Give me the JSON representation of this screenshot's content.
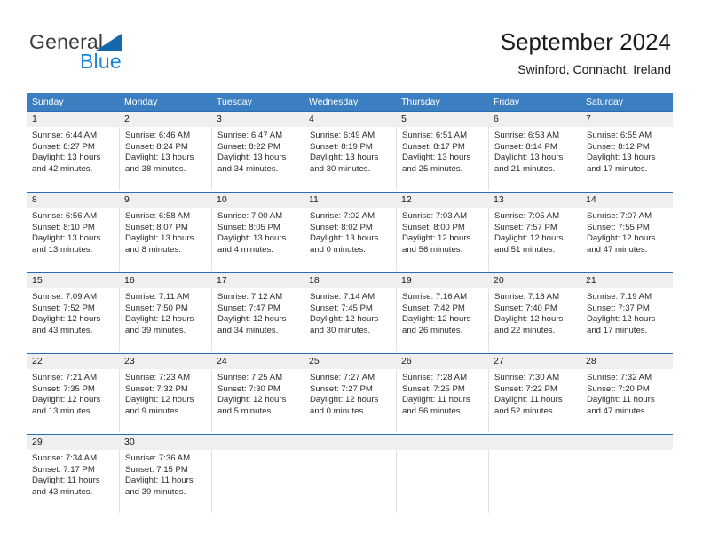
{
  "brand": {
    "name_top": "General",
    "name_bottom": "Blue",
    "triangle_color": "#1469ad",
    "blue_color": "#1c86d6"
  },
  "header": {
    "title": "September 2024",
    "subtitle": "Swinford, Connacht, Ireland"
  },
  "theme": {
    "header_bar": "#3c7fc0",
    "week_separator": "#2a6db3",
    "day_band": "#efefef",
    "cell_divider": "#e2e2e2",
    "text": "#1a1a1a"
  },
  "weekdays": [
    "Sunday",
    "Monday",
    "Tuesday",
    "Wednesday",
    "Thursday",
    "Friday",
    "Saturday"
  ],
  "weeks": [
    [
      {
        "day": "1",
        "sunrise": "Sunrise: 6:44 AM",
        "sunset": "Sunset: 8:27 PM",
        "daylight1": "Daylight: 13 hours",
        "daylight2": "and 42 minutes."
      },
      {
        "day": "2",
        "sunrise": "Sunrise: 6:46 AM",
        "sunset": "Sunset: 8:24 PM",
        "daylight1": "Daylight: 13 hours",
        "daylight2": "and 38 minutes."
      },
      {
        "day": "3",
        "sunrise": "Sunrise: 6:47 AM",
        "sunset": "Sunset: 8:22 PM",
        "daylight1": "Daylight: 13 hours",
        "daylight2": "and 34 minutes."
      },
      {
        "day": "4",
        "sunrise": "Sunrise: 6:49 AM",
        "sunset": "Sunset: 8:19 PM",
        "daylight1": "Daylight: 13 hours",
        "daylight2": "and 30 minutes."
      },
      {
        "day": "5",
        "sunrise": "Sunrise: 6:51 AM",
        "sunset": "Sunset: 8:17 PM",
        "daylight1": "Daylight: 13 hours",
        "daylight2": "and 25 minutes."
      },
      {
        "day": "6",
        "sunrise": "Sunrise: 6:53 AM",
        "sunset": "Sunset: 8:14 PM",
        "daylight1": "Daylight: 13 hours",
        "daylight2": "and 21 minutes."
      },
      {
        "day": "7",
        "sunrise": "Sunrise: 6:55 AM",
        "sunset": "Sunset: 8:12 PM",
        "daylight1": "Daylight: 13 hours",
        "daylight2": "and 17 minutes."
      }
    ],
    [
      {
        "day": "8",
        "sunrise": "Sunrise: 6:56 AM",
        "sunset": "Sunset: 8:10 PM",
        "daylight1": "Daylight: 13 hours",
        "daylight2": "and 13 minutes."
      },
      {
        "day": "9",
        "sunrise": "Sunrise: 6:58 AM",
        "sunset": "Sunset: 8:07 PM",
        "daylight1": "Daylight: 13 hours",
        "daylight2": "and 8 minutes."
      },
      {
        "day": "10",
        "sunrise": "Sunrise: 7:00 AM",
        "sunset": "Sunset: 8:05 PM",
        "daylight1": "Daylight: 13 hours",
        "daylight2": "and 4 minutes."
      },
      {
        "day": "11",
        "sunrise": "Sunrise: 7:02 AM",
        "sunset": "Sunset: 8:02 PM",
        "daylight1": "Daylight: 13 hours",
        "daylight2": "and 0 minutes."
      },
      {
        "day": "12",
        "sunrise": "Sunrise: 7:03 AM",
        "sunset": "Sunset: 8:00 PM",
        "daylight1": "Daylight: 12 hours",
        "daylight2": "and 56 minutes."
      },
      {
        "day": "13",
        "sunrise": "Sunrise: 7:05 AM",
        "sunset": "Sunset: 7:57 PM",
        "daylight1": "Daylight: 12 hours",
        "daylight2": "and 51 minutes."
      },
      {
        "day": "14",
        "sunrise": "Sunrise: 7:07 AM",
        "sunset": "Sunset: 7:55 PM",
        "daylight1": "Daylight: 12 hours",
        "daylight2": "and 47 minutes."
      }
    ],
    [
      {
        "day": "15",
        "sunrise": "Sunrise: 7:09 AM",
        "sunset": "Sunset: 7:52 PM",
        "daylight1": "Daylight: 12 hours",
        "daylight2": "and 43 minutes."
      },
      {
        "day": "16",
        "sunrise": "Sunrise: 7:11 AM",
        "sunset": "Sunset: 7:50 PM",
        "daylight1": "Daylight: 12 hours",
        "daylight2": "and 39 minutes."
      },
      {
        "day": "17",
        "sunrise": "Sunrise: 7:12 AM",
        "sunset": "Sunset: 7:47 PM",
        "daylight1": "Daylight: 12 hours",
        "daylight2": "and 34 minutes."
      },
      {
        "day": "18",
        "sunrise": "Sunrise: 7:14 AM",
        "sunset": "Sunset: 7:45 PM",
        "daylight1": "Daylight: 12 hours",
        "daylight2": "and 30 minutes."
      },
      {
        "day": "19",
        "sunrise": "Sunrise: 7:16 AM",
        "sunset": "Sunset: 7:42 PM",
        "daylight1": "Daylight: 12 hours",
        "daylight2": "and 26 minutes."
      },
      {
        "day": "20",
        "sunrise": "Sunrise: 7:18 AM",
        "sunset": "Sunset: 7:40 PM",
        "daylight1": "Daylight: 12 hours",
        "daylight2": "and 22 minutes."
      },
      {
        "day": "21",
        "sunrise": "Sunrise: 7:19 AM",
        "sunset": "Sunset: 7:37 PM",
        "daylight1": "Daylight: 12 hours",
        "daylight2": "and 17 minutes."
      }
    ],
    [
      {
        "day": "22",
        "sunrise": "Sunrise: 7:21 AM",
        "sunset": "Sunset: 7:35 PM",
        "daylight1": "Daylight: 12 hours",
        "daylight2": "and 13 minutes."
      },
      {
        "day": "23",
        "sunrise": "Sunrise: 7:23 AM",
        "sunset": "Sunset: 7:32 PM",
        "daylight1": "Daylight: 12 hours",
        "daylight2": "and 9 minutes."
      },
      {
        "day": "24",
        "sunrise": "Sunrise: 7:25 AM",
        "sunset": "Sunset: 7:30 PM",
        "daylight1": "Daylight: 12 hours",
        "daylight2": "and 5 minutes."
      },
      {
        "day": "25",
        "sunrise": "Sunrise: 7:27 AM",
        "sunset": "Sunset: 7:27 PM",
        "daylight1": "Daylight: 12 hours",
        "daylight2": "and 0 minutes."
      },
      {
        "day": "26",
        "sunrise": "Sunrise: 7:28 AM",
        "sunset": "Sunset: 7:25 PM",
        "daylight1": "Daylight: 11 hours",
        "daylight2": "and 56 minutes."
      },
      {
        "day": "27",
        "sunrise": "Sunrise: 7:30 AM",
        "sunset": "Sunset: 7:22 PM",
        "daylight1": "Daylight: 11 hours",
        "daylight2": "and 52 minutes."
      },
      {
        "day": "28",
        "sunrise": "Sunrise: 7:32 AM",
        "sunset": "Sunset: 7:20 PM",
        "daylight1": "Daylight: 11 hours",
        "daylight2": "and 47 minutes."
      }
    ],
    [
      {
        "day": "29",
        "sunrise": "Sunrise: 7:34 AM",
        "sunset": "Sunset: 7:17 PM",
        "daylight1": "Daylight: 11 hours",
        "daylight2": "and 43 minutes."
      },
      {
        "day": "30",
        "sunrise": "Sunrise: 7:36 AM",
        "sunset": "Sunset: 7:15 PM",
        "daylight1": "Daylight: 11 hours",
        "daylight2": "and 39 minutes."
      },
      {
        "day": "",
        "sunrise": "",
        "sunset": "",
        "daylight1": "",
        "daylight2": ""
      },
      {
        "day": "",
        "sunrise": "",
        "sunset": "",
        "daylight1": "",
        "daylight2": ""
      },
      {
        "day": "",
        "sunrise": "",
        "sunset": "",
        "daylight1": "",
        "daylight2": ""
      },
      {
        "day": "",
        "sunrise": "",
        "sunset": "",
        "daylight1": "",
        "daylight2": ""
      },
      {
        "day": "",
        "sunrise": "",
        "sunset": "",
        "daylight1": "",
        "daylight2": ""
      }
    ]
  ]
}
